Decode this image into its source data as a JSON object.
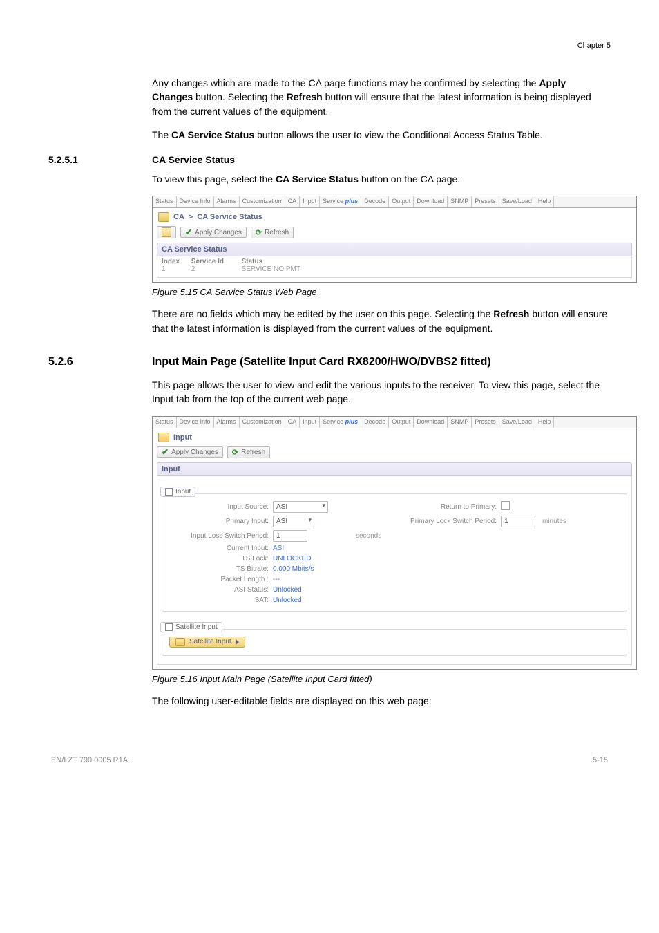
{
  "header": {
    "chapter": "Chapter 5"
  },
  "para1_a": "Any changes which are made to the CA page functions may be confirmed by selecting the ",
  "para1_b": "Apply Changes",
  "para1_c": " button. Selecting the ",
  "para1_d": "Refresh",
  "para1_e": " button will ensure that the latest information is being displayed from the current values of the equipment.",
  "para2_a": "The ",
  "para2_b": "CA Service Status",
  "para2_c": " button allows the user to view the Conditional Access Status Table.",
  "sec5251_num": "5.2.5.1",
  "sec5251_title": "CA Service Status",
  "para3_a": "To view this page, select the ",
  "para3_b": "CA Service Status",
  "para3_c": " button on the CA page.",
  "tabs": {
    "status": "Status",
    "device_info": "Device Info",
    "alarms": "Alarms",
    "customization": "Customization",
    "ca": "CA",
    "input": "Input",
    "service_pre": "Service ",
    "service_suf": "plus",
    "decode": "Decode",
    "output": "Output",
    "download": "Download",
    "snmp": "SNMP",
    "presets": "Presets",
    "saveload": "Save/Load",
    "help": "Help"
  },
  "ca_screenshot": {
    "breadcrumb_a": "CA",
    "breadcrumb_b": "CA Service Status",
    "btn_apply": "Apply Changes",
    "btn_refresh": "Refresh",
    "panel_title": "CA Service Status",
    "th_index": "Index",
    "th_service_id": "Service Id",
    "th_status": "Status",
    "row_index": "1",
    "row_service_id": "2",
    "row_status": "SERVICE NO PMT"
  },
  "fig515_caption": "Figure 5.15 CA Service Status Web Page",
  "para4_a": "There are no fields which may be edited by the user on this page. Selecting the ",
  "para4_b": "Refresh",
  "para4_c": " button will ensure that the latest information is displayed from the current values of the equipment.",
  "sec526_num": "5.2.6",
  "sec526_title": "Input Main Page (Satellite Input Card RX8200/HWO/DVBS2 fitted)",
  "para5": "This page allows the user to view and edit the various inputs to the receiver. To view this page, select the Input tab from the top of the current web page.",
  "input_screenshot": {
    "breadcrumb": "Input",
    "btn_apply": "Apply Changes",
    "btn_refresh": "Refresh",
    "section_title": "Input",
    "group_input_label": "Input",
    "lbl_input_source": "Input Source:",
    "val_input_source": "ASI",
    "lbl_return_primary": "Return to Primary:",
    "lbl_primary_input": "Primary Input:",
    "val_primary_input": "ASI",
    "lbl_primary_lock": "Primary Lock Switch Period:",
    "val_primary_lock": "1",
    "unit_minutes": "minutes",
    "lbl_input_loss": "Input Loss Switch Period:",
    "val_input_loss": "1",
    "unit_seconds": "seconds",
    "lbl_current_input": "Current Input:",
    "val_current_input": "ASI",
    "lbl_ts_lock": "TS Lock:",
    "val_ts_lock": "UNLOCKED",
    "lbl_ts_bitrate": "TS Bitrate:",
    "val_ts_bitrate": "0.000 Mbits/s",
    "lbl_packet_len": "Packet Length :",
    "val_packet_len": "---",
    "lbl_asi_status": "ASI Status:",
    "val_asi_status": "Unlocked",
    "lbl_sat": "SAT:",
    "val_sat": "Unlocked",
    "group_sat_label": "Satellite Input",
    "sat_link_label": "Satellite Input"
  },
  "fig516_caption": "Figure 5.16 Input Main Page (Satellite Input Card fitted)",
  "para6": "The following user-editable fields are displayed on this web page:",
  "footer": {
    "left": "EN/LZT 790 0005 R1A",
    "right": "5-15"
  }
}
